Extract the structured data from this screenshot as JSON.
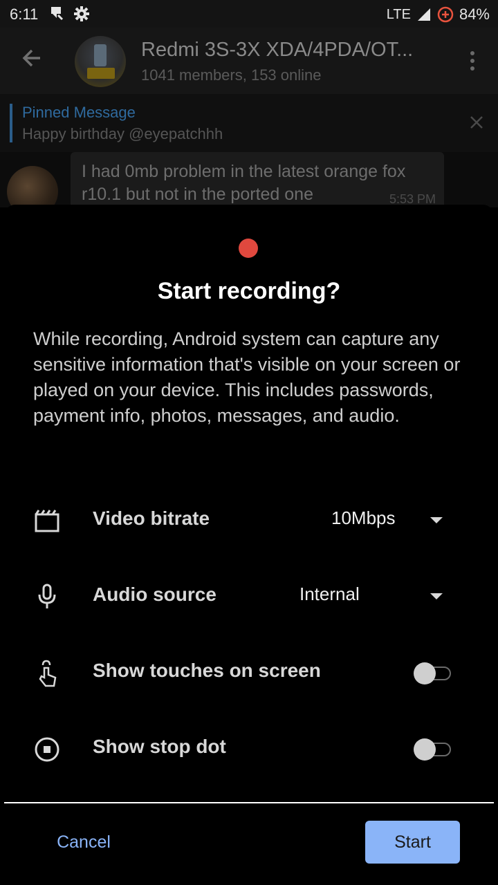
{
  "status_bar": {
    "time": "6:11",
    "network": "LTE",
    "battery": "84%"
  },
  "chat": {
    "title": "Redmi 3S-3X XDA/4PDA/OT...",
    "subtitle": "1041 members, 153 online",
    "pinned": {
      "title": "Pinned Message",
      "text": "Happy birthday @eyepatchhh"
    },
    "message": {
      "text": "I had 0mb problem in the latest orange fox r10.1 but not in the ported one",
      "time": "5:53 PM"
    }
  },
  "dialog": {
    "title": "Start recording?",
    "body": "While recording, Android system can capture any sensitive information that's visible on your screen or played on your device. This includes passwords, payment info, photos, messages, and audio.",
    "options": {
      "video_bitrate": {
        "label": "Video bitrate",
        "value": "10Mbps"
      },
      "audio_source": {
        "label": "Audio source",
        "value": "Internal"
      },
      "show_touches": {
        "label": "Show touches on screen",
        "enabled": false
      },
      "show_stop_dot": {
        "label": "Show stop dot",
        "enabled": false
      }
    },
    "cancel_label": "Cancel",
    "start_label": "Start"
  },
  "colors": {
    "accent": "#8ab4f8",
    "record_dot": "#e0483e",
    "sheet_bg": "#000000"
  }
}
